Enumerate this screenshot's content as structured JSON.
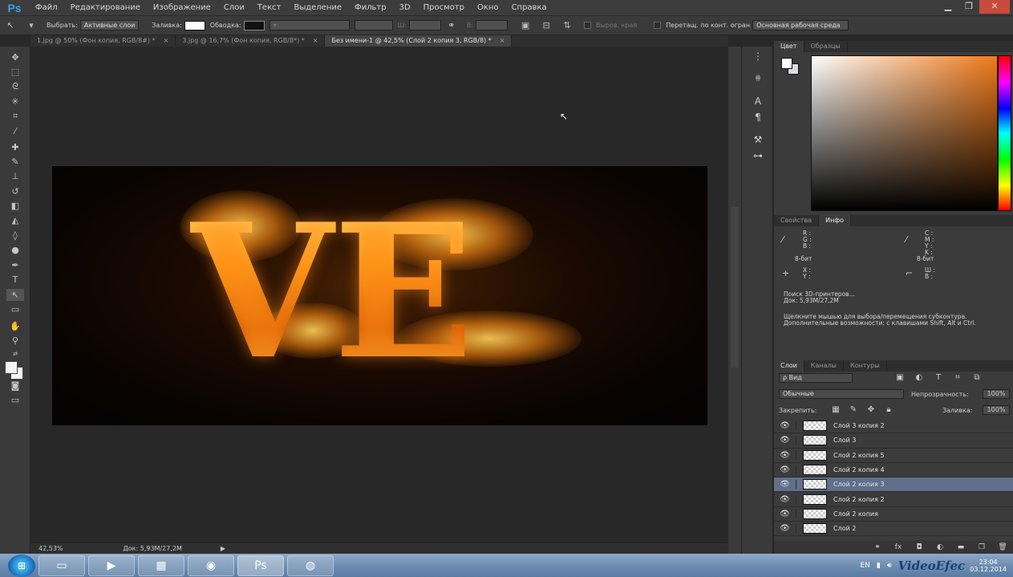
{
  "app": {
    "logo": "Ps"
  },
  "menu": [
    "Файл",
    "Редактирование",
    "Изображение",
    "Слои",
    "Текст",
    "Выделение",
    "Фильтр",
    "3D",
    "Просмотр",
    "Окно",
    "Справка"
  ],
  "window_controls": {
    "minimize": "▁",
    "restore": "❐",
    "close": "✕"
  },
  "options": {
    "select_label": "Выбрать:",
    "select_value": "Активные слои",
    "fill_label": "Заливка:",
    "stroke_label": "Обводка:",
    "w_label": "Ш:",
    "h_label": "В:",
    "align_edges": "Выров. края",
    "drag_label": "Перетащ. по конт. огран",
    "workspace": "Основная рабочая среда"
  },
  "tabs": [
    {
      "label": "1.jpg @ 50% (Фон копия, RGB/8#) *",
      "close": "×"
    },
    {
      "label": "3.jpg @ 16,7% (Фон копия, RGB/8*) *",
      "close": "×"
    },
    {
      "label": "Без имени-1 @ 42,5% (Слой 2 копия 3, RGB/8) *",
      "close": "×"
    }
  ],
  "canvas": {
    "text": "VE"
  },
  "status": {
    "zoom": "42,53%",
    "doc": "Док: 5,93M/27,2M",
    "arrow": "▶"
  },
  "color_panel": {
    "tabs": [
      "Цвет",
      "Образцы"
    ]
  },
  "info_panel": {
    "tabs": [
      "Свойства",
      "Инфо"
    ],
    "rgb": [
      "R :",
      "G :",
      "B :"
    ],
    "cmyk": [
      "C :",
      "M :",
      "Y :",
      "K :"
    ],
    "bits_left": "8-бит",
    "bits_right": "8-бит",
    "xy": [
      "X :",
      "Y :"
    ],
    "wh": [
      "Ш :",
      "В :"
    ],
    "msg1": "Поиск 3D-принтеров...",
    "msg2": "Док: 5,93M/27,2M",
    "msg3": "Щелкните мышью для выбора/перемещения субконтура.",
    "msg4": "Дополнительные возможности: с клавишами Shift, Alt и Ctrl."
  },
  "layers_panel": {
    "tabs": [
      "Слои",
      "Каналы",
      "Контуры"
    ],
    "search": "ρ Вид",
    "blend": "Обычные",
    "opacity_label": "Непрозрачность:",
    "opacity": "100%",
    "lock_label": "Закрепить:",
    "fill_label": "Заливка:",
    "fill": "100%",
    "layers": [
      {
        "name": "Слой 3 копия 2",
        "selected": false
      },
      {
        "name": "Слой 3",
        "selected": false
      },
      {
        "name": "Слой 2 копия 5",
        "selected": false
      },
      {
        "name": "Слой 2 копия 4",
        "selected": false
      },
      {
        "name": "Слой 2 копия 3",
        "selected": true
      },
      {
        "name": "Слой 2 копия 2",
        "selected": false
      },
      {
        "name": "Слой 2 копия",
        "selected": false
      },
      {
        "name": "Слой 2",
        "selected": false
      }
    ]
  },
  "taskbar": {
    "tray_lang": "EN",
    "watermark": "VideoEfec",
    "clock_time": "23:04",
    "clock_date": "03.12.2014"
  },
  "colors": {
    "accent": "#2fa3e8",
    "selected_layer": "#5f6f8c",
    "close_button": "#c74b3c"
  }
}
